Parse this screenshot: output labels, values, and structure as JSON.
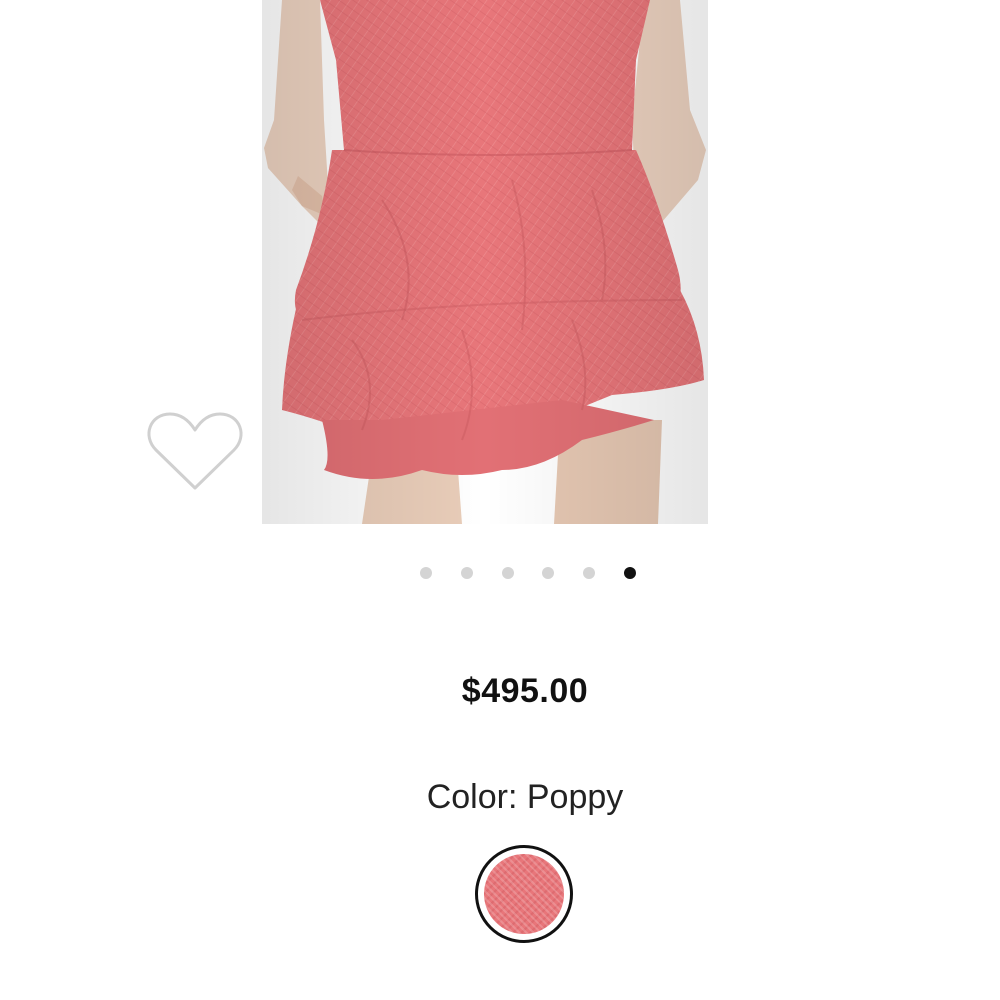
{
  "product": {
    "price": "$495.00",
    "color_label": "Color: Poppy",
    "color_name": "Poppy",
    "swatch_color": "#e8767a"
  },
  "carousel": {
    "total_images": 6,
    "active_index": 5
  },
  "wishlist": {
    "icon": "heart-outline-icon"
  },
  "colors": {
    "skirt": "#e8767a",
    "dot_inactive": "#d4d4d4",
    "dot_active": "#111111"
  }
}
